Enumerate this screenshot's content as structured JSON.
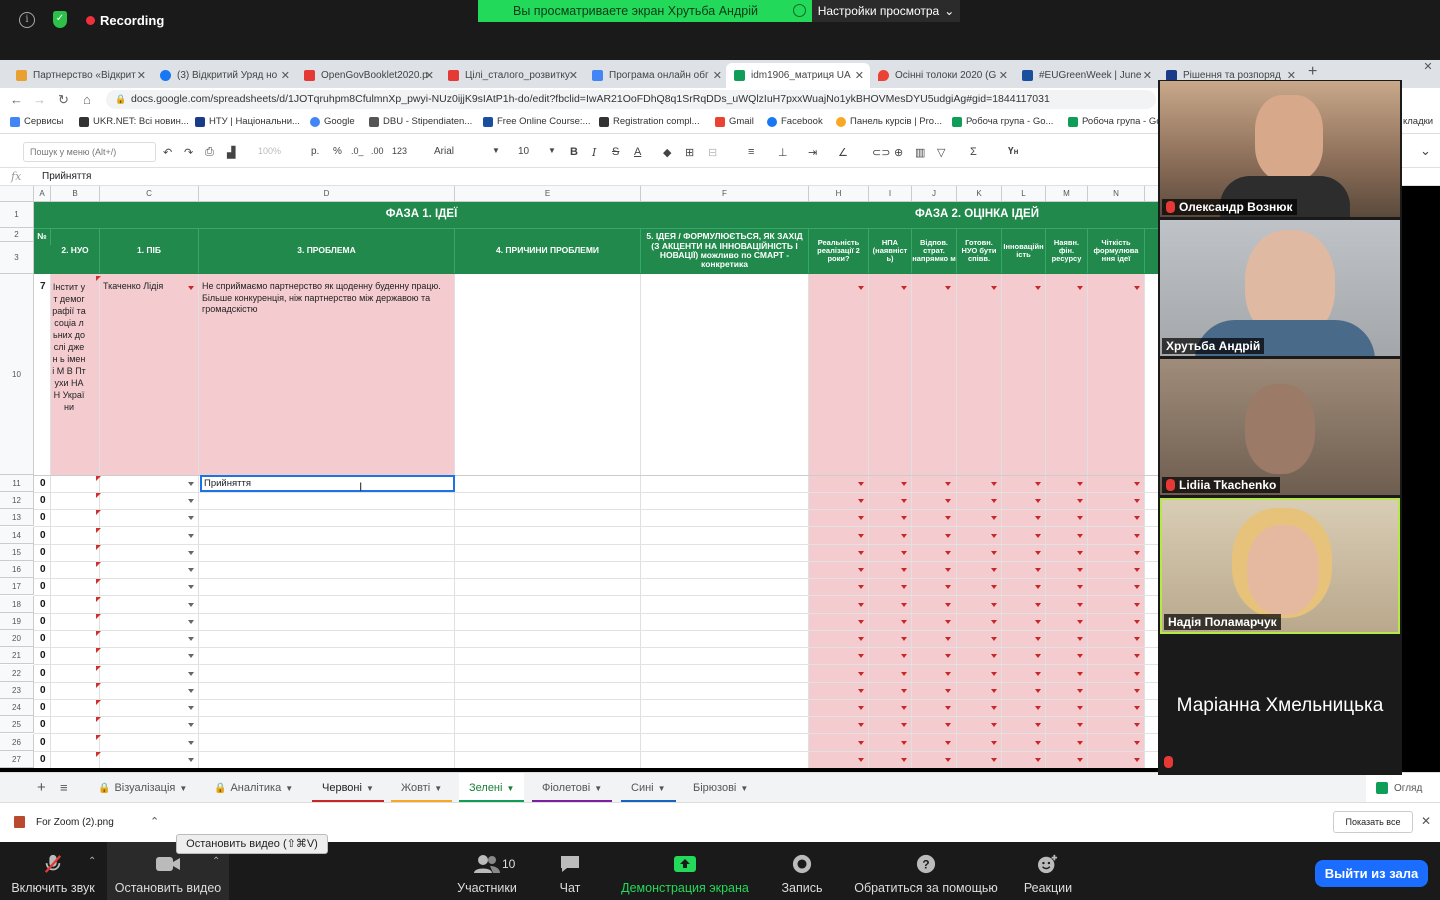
{
  "zoom_top": {
    "recording_label": "Recording",
    "share_banner": "Вы просматриваете экран Хрутьба Андрій",
    "view_options": "Настройки просмотра"
  },
  "chrome": {
    "tabs": [
      {
        "label": "Партнерство «Відкрит",
        "color": "#e8a030"
      },
      {
        "label": "(3) Відкритий Уряд но",
        "color": "#1877f2"
      },
      {
        "label": "OpenGovBooklet2020.p",
        "color": "#e53935"
      },
      {
        "label": "Цілі_сталого_розвитку",
        "color": "#e53935"
      },
      {
        "label": "Програма онлайн обг",
        "color": "#4285f4"
      },
      {
        "label": "idm1906_матриця UA",
        "color": "#0f9d58"
      },
      {
        "label": "Осінні толоки 2020 (G",
        "color": "#ea4335"
      },
      {
        "label": "#EUGreenWeek | June",
        "color": "#1a4fa0"
      },
      {
        "label": "Рішення та розпоряд",
        "color": "#1a3a8a"
      }
    ],
    "url": "docs.google.com/spreadsheets/d/1JOTqruhpm8CfulmnXp_pwyi-NUz0ijjK9sIAtP1h-do/edit?fbclid=IwAR21OoFDhQ8q1SrRqDDs_uWQlzIuH7pxxWuajNo1ykBHOVMesDYU5udgiAg#gid=1844117031",
    "bookmarks": [
      {
        "label": "Сервисы",
        "color": "#4285f4"
      },
      {
        "label": "UKR.NET: Всі новин...",
        "color": "#333"
      },
      {
        "label": "НТУ | Національни...",
        "color": "#1a3a8a"
      },
      {
        "label": "Google",
        "color": "#4285f4"
      },
      {
        "label": "DBU - Stipendiaten...",
        "color": "#555"
      },
      {
        "label": "Free Online Course:...",
        "color": "#1a4fa0"
      },
      {
        "label": "Registration compl...",
        "color": "#333"
      },
      {
        "label": "Gmail",
        "color": "#ea4335"
      },
      {
        "label": "Facebook",
        "color": "#1877f2"
      },
      {
        "label": "Панель курсів | Pro...",
        "color": "#f9a825"
      },
      {
        "label": "Робоча група - Go...",
        "color": "#0f9d58"
      },
      {
        "label": "Робоча група - Go",
        "color": "#0f9d58"
      }
    ],
    "bookmarks_overflow": "кладки"
  },
  "sheet": {
    "menu_search_placeholder": "Пошук у меню (Alt+/)",
    "zoom": "100%",
    "currency": "р.",
    "percent": "%",
    "dec_minus": ".0_",
    "dec_plus": ".00",
    "format": "123",
    "font": "Arial",
    "font_size": "10",
    "formula_value": "Прийняття",
    "columns": [
      "A",
      "B",
      "C",
      "D",
      "E",
      "F",
      "H",
      "I",
      "J",
      "K",
      "L",
      "M",
      "N"
    ],
    "phase1": "ФАЗА 1. ІДЕЇ",
    "phase2": "ФАЗА 2. ОЦІНКА ІДЕЙ",
    "headers": {
      "no": "№",
      "nuo": "2. НУО",
      "pib": "1. ПІБ",
      "problem": "3. ПРОБЛЕМА",
      "causes": "4. ПРИЧИНИ ПРОБЛЕМИ",
      "idea": "5. ІДЕЯ / ФОРМУЛЮЄТЬСЯ, ЯК ЗАХІД (З АКЦЕНТИ НА ІННОВАЦІЙНІСТЬ І НОВАЦІЇ) можливо по СМАРТ - конкретика",
      "h": "Реальність реалізації 2 роки?",
      "i": "НПА (наявніст ь)",
      "j": "Відпов. страт. напрямко м",
      "k": "Готовн. НУО бути співв.",
      "l": "Інноваційн ість",
      "m": "Наявн. фін. ресурсу",
      "n": "Чіткість формулюва ння ідеї"
    },
    "row10": {
      "num": "10",
      "no": "7",
      "nuo": "Інстит ут демог рафії та соціа льних дослі джен ь імені М В Птухи НАН Украї ни",
      "pib": "Ткаченко Лідія",
      "problem": "Не сприймаємо партнерство як щоденну буденну працю. Більше конкуренція, ніж партнерство між державою та громадскістю"
    },
    "row11_input": "Прийняття",
    "rows": [
      "11",
      "12",
      "13",
      "14",
      "15",
      "16",
      "17",
      "18",
      "19",
      "20",
      "21",
      "22",
      "23",
      "24",
      "25",
      "26",
      "27"
    ],
    "zero": "0",
    "row_labels_top": [
      "1",
      "2",
      "3"
    ],
    "tabs": [
      {
        "label": "Візуалізація",
        "lock": true,
        "color": ""
      },
      {
        "label": "Аналітика",
        "lock": true,
        "color": ""
      },
      {
        "label": "Червоні",
        "lock": false,
        "color": "#c62828"
      },
      {
        "label": "Жовті",
        "lock": false,
        "color": "#f9a825"
      },
      {
        "label": "Зелені",
        "lock": false,
        "color": "#0f9d58"
      },
      {
        "label": "Фіолетові",
        "lock": false,
        "color": "#7b1fa2"
      },
      {
        "label": "Сині",
        "lock": false,
        "color": "#1565c0"
      },
      {
        "label": "Бірюзові",
        "lock": false,
        "color": ""
      }
    ],
    "explore": "Огляд"
  },
  "download": {
    "file": "For Zoom (2).png",
    "show_all": "Показать все"
  },
  "zoom_bottom": {
    "mute": "Включить звук",
    "video": "Остановить видео",
    "video_tooltip": "Остановить видео (⇧⌘V)",
    "participants": "Участники",
    "participant_count": "10",
    "chat": "Чат",
    "share": "Демонстрация экрана",
    "record": "Запись",
    "help": "Обратиться за помощью",
    "reactions": "Реакции",
    "leave": "Выйти из зала"
  },
  "videos": [
    {
      "name": "Олександр Вознюк",
      "muted": true,
      "bg": "#8a6d58"
    },
    {
      "name": "Хрутьба Андрій",
      "muted": false,
      "bg": "#a3a7aa"
    },
    {
      "name": "Lidiia Tkachenko",
      "muted": true,
      "bg": "#7d6a5c"
    },
    {
      "name": "Надія Поламарчук",
      "muted": false,
      "bg": "#c9b79a"
    },
    {
      "name": "Маріанна Хмельницька",
      "muted": true,
      "bg": "#1a1a1a"
    }
  ]
}
